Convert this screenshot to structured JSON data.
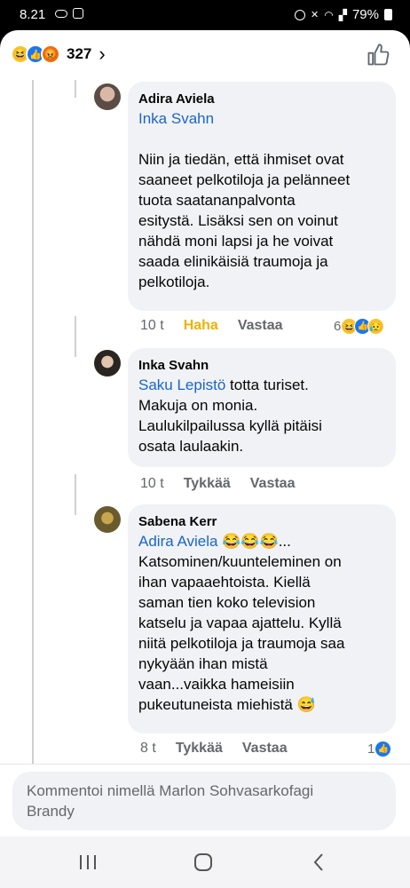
{
  "status_bar": {
    "time": "8.21",
    "battery": "79%",
    "icons": [
      "cloud-icon",
      "instagram-icon",
      "alarm-icon",
      "mute-icon",
      "wifi-icon",
      "signal-icon",
      "battery-icon"
    ]
  },
  "header": {
    "reaction_count": "327",
    "reaction_icons": [
      "haha",
      "like",
      "angry"
    ]
  },
  "comments": [
    {
      "author": "Adira Aviela",
      "mention": "Inka Svahn",
      "text_lines": [
        "Niin ja tiedän, että ihmiset ovat",
        "saaneet pelkotiloja ja pelänneet",
        "tuota saatananpalvonta",
        "esitystä. Lisäksi sen on voinut",
        "nähdä moni lapsi ja he voivat",
        "saada elinikäisiä traumoja ja",
        "pelkotiloja."
      ],
      "time": "10 t",
      "action_react": "Haha",
      "action_reply": "Vastaa",
      "reaction_count": "6",
      "reactions": [
        "haha",
        "like",
        "sad"
      ]
    },
    {
      "author": "Inka Svahn",
      "mention": "Saku Lepistö",
      "mention_tail": " totta turiset.",
      "text_lines": [
        "Makuja on monia.",
        "Laulukilpailussa kyllä pitäisi",
        "osata laulaakin."
      ],
      "time": "10 t",
      "action_react": "Tykkää",
      "action_reply": "Vastaa"
    },
    {
      "author": "Sabena Kerr",
      "mention": "Adira Aviela",
      "mention_tail": " 😂😂😂...",
      "text_lines": [
        "Katsominen/kuunteleminen on",
        "ihan vapaaehtoista. Kiellä",
        "saman tien koko television",
        "katselu ja vapaa ajattelu. Kyllä",
        "niitä pelkotiloja ja traumoja saa",
        "nykyään ihan mistä",
        "vaan...vaikka hameisiin",
        "pukeutuneista miehistä 😅"
      ],
      "time": "8 t",
      "action_react": "Tykkää",
      "action_reply": "Vastaa",
      "reaction_count": "1",
      "reactions": [
        "like"
      ]
    }
  ],
  "composer": {
    "placeholder_line1": "Kommentoi nimellä Marlon Sohvasarkofagi",
    "placeholder_line2": "Brandy"
  }
}
